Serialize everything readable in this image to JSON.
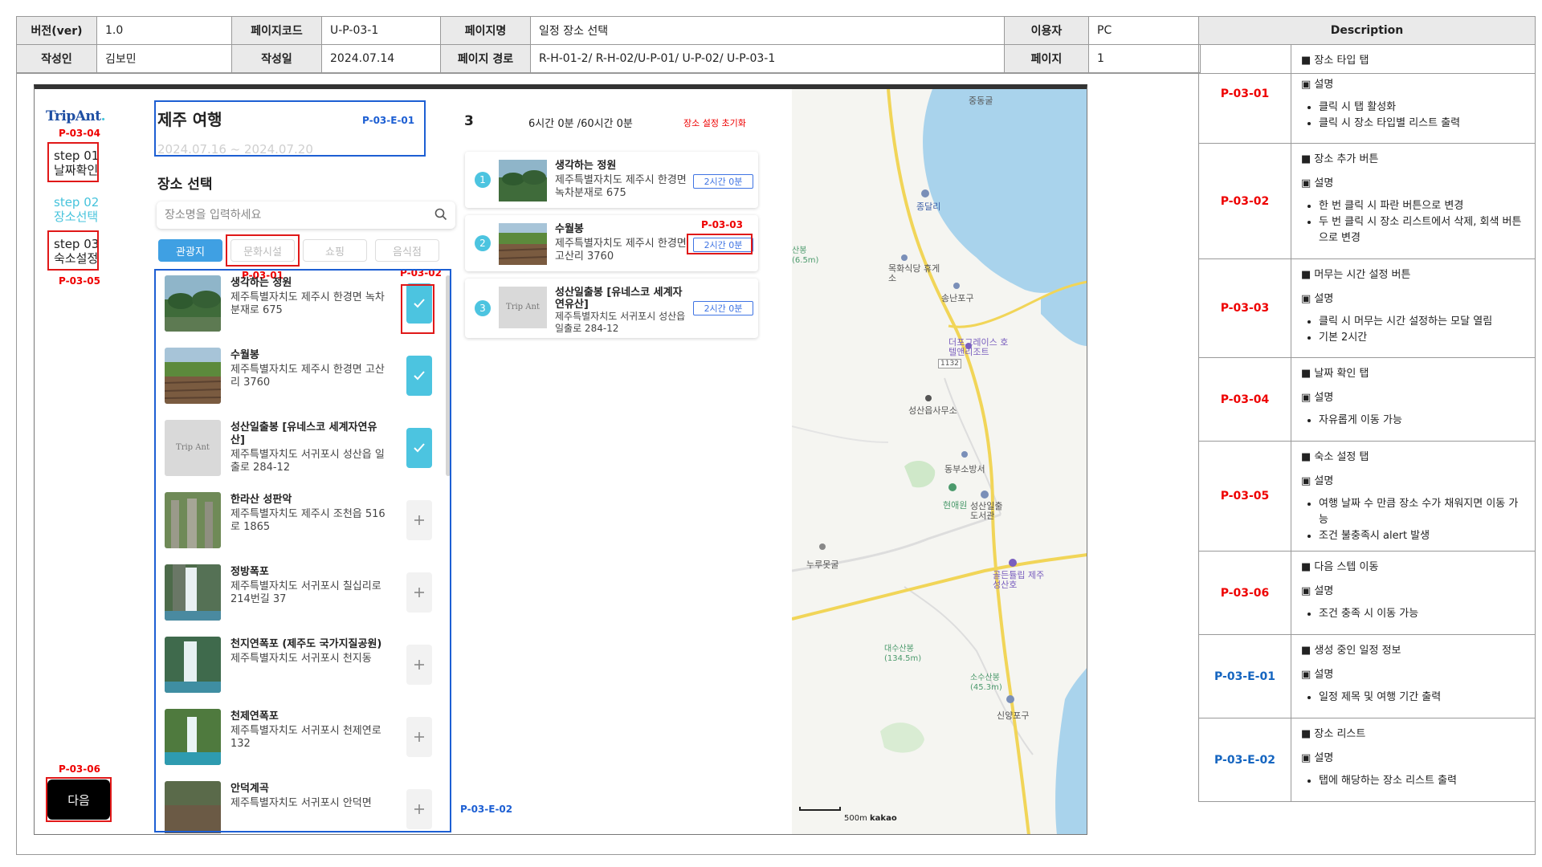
{
  "meta": {
    "version_label": "버전(ver)",
    "version": "1.0",
    "pagecode_label": "페이지코드",
    "pagecode": "U-P-03-1",
    "pagename_label": "페이지명",
    "pagename": "일정 장소 선택",
    "user_label": "이용자",
    "user": "PC",
    "author_label": "작성인",
    "author": "김보민",
    "date_label": "작성일",
    "date": "2024.07.14",
    "path_label": "페이지 경로",
    "path": "R-H-01-2/ R-H-02/U-P-01/ U-P-02/ U-P-03-1",
    "page_label": "페이지",
    "page": "1"
  },
  "description": {
    "header": "Description",
    "rows": [
      {
        "code": "P-03-01",
        "title": "■ 장소 타입 탭",
        "sub": "▣ 설명",
        "items": [
          "클릭 시 탭 활성화",
          "클릭 시 장소 타입별 리스트 출력"
        ]
      },
      {
        "code": "P-03-02",
        "title": "■ 장소 추가 버튼",
        "sub": "▣ 설명",
        "items": [
          "한 번 클릭 시 파란 버튼으로 변경",
          "두 번 클릭 시 장소 리스트에서 삭제, 회색 버튼으로 변경"
        ]
      },
      {
        "code": "P-03-03",
        "title": "■ 머무는 시간 설정 버튼",
        "sub": "▣ 설명",
        "items": [
          "클릭 시 머무는 시간 설정하는 모달 열림",
          "기본 2시간"
        ]
      },
      {
        "code": "P-03-04",
        "title": "■ 날짜 확인 탭",
        "sub": "▣ 설명",
        "items": [
          "자유롭게 이동 가능"
        ]
      },
      {
        "code": "P-03-05",
        "title": "■ 숙소 설정 탭",
        "sub": "▣ 설명",
        "items": [
          "여행 날짜 수 만큼 장소 수가 채워지면 이동 가능",
          "조건 불충족시 alert 발생"
        ]
      },
      {
        "code": "P-03-06",
        "title": "■ 다음 스텝 이동",
        "sub": "▣ 설명",
        "items": [
          "조건 충족 시 이동 가능"
        ]
      },
      {
        "code": "P-03-E-01",
        "title": "■ 생성 중인 일정 정보",
        "sub": "▣ 설명",
        "items": [
          "일정 제목 및 여행 기간 출력"
        ]
      },
      {
        "code": "P-03-E-02",
        "title": "■ 장소 리스트",
        "sub": "▣ 설명",
        "items": [
          "탭에 해당하는 장소 리스트 출력"
        ]
      }
    ]
  },
  "app": {
    "logo": "TripAnt",
    "logo_dot": ".",
    "steps": [
      {
        "line1": "step 01",
        "line2": "날짜확인"
      },
      {
        "line1": "step 02",
        "line2": "장소선택"
      },
      {
        "line1": "step 03",
        "line2": "숙소설정"
      }
    ],
    "next_label": "다음",
    "trip_title": "제주 여행",
    "trip_dates": "2024.07.16 ~ 2024.07.20",
    "section_title": "장소 선택",
    "search_placeholder": "장소명을 입력하세요",
    "tabs": [
      "관광지",
      "문화시설",
      "쇼핑",
      "음식점"
    ],
    "places": [
      {
        "name": "생각하는 정원",
        "addr": "제주특별자치도 제주시 한경면 녹차분재로 675",
        "selected": true
      },
      {
        "name": "수월봉",
        "addr": "제주특별자치도 제주시 한경면 고산리 3760",
        "selected": true
      },
      {
        "name": "성산일출봉 [유네스코 세계자연유산]",
        "addr": "제주특별자치도 서귀포시 성산읍 일출로 284-12",
        "selected": true
      },
      {
        "name": "한라산 성판악",
        "addr": "제주특별자치도 제주시 조천읍 516로 1865",
        "selected": false
      },
      {
        "name": "정방폭포",
        "addr": "제주특별자치도 서귀포시 칠십리로 214번길 37",
        "selected": false
      },
      {
        "name": "천지연폭포 (제주도 국가지질공원)",
        "addr": "제주특별자치도 서귀포시 천지동",
        "selected": false
      },
      {
        "name": "천제연폭포",
        "addr": "제주특별자치도 서귀포시 천제연로 132",
        "selected": false
      },
      {
        "name": "안덕계곡",
        "addr": "제주특별자치도 서귀포시 안덕면",
        "selected": false
      }
    ],
    "thumb_placeholder": "Trip Ant",
    "schedule": {
      "count": "3",
      "time": "6시간 0분 /60시간 0분",
      "reset": "장소 설정 초기화",
      "cards": [
        {
          "num": "1",
          "name": "생각하는 정원",
          "addr": "제주특별자치도 제주시 한경면 녹차분재로 675",
          "duration": "2시간 0분"
        },
        {
          "num": "2",
          "name": "수월봉",
          "addr": "제주특별자치도 제주시 한경면 고산리 3760",
          "duration": "2시간 0분"
        },
        {
          "num": "3",
          "name": "성산일출봉 [유네스코 세계자연유산]",
          "addr": "제주특별자치도 서귀포시 성산읍 일출로 284-12",
          "duration": "2시간 0분"
        }
      ]
    },
    "map": {
      "labels": [
        "종달리",
        "중동굴",
        "목화식당 휴게소",
        "송난포구",
        "더포그레이스 호텔앤리조트",
        "성산읍사무소",
        "동부소방서",
        "현애원",
        "성산일출 도서관",
        "누루못굴",
        "골든튤립 제주성산호",
        "대수산봉 (134.5m)",
        "소수산봉 (45.3m)",
        "신양포구",
        "산봉 (6.5m)"
      ],
      "road_number": "1132",
      "scale_label": "500m",
      "brand": "kakao"
    }
  },
  "annotations": {
    "p0301": "P-03-01",
    "p0302": "P-03-02",
    "p0303": "P-03-03",
    "p0304": "P-03-04",
    "p0305": "P-03-05",
    "p0306": "P-03-06",
    "pe01": "P-03-E-01",
    "pe02": "P-03-E-02"
  },
  "colors": {
    "accent": "#4cc4e0",
    "tab_active": "#3fa0e3",
    "annotation_red": "#e01818",
    "annotation_blue": "#1d5fd3"
  }
}
